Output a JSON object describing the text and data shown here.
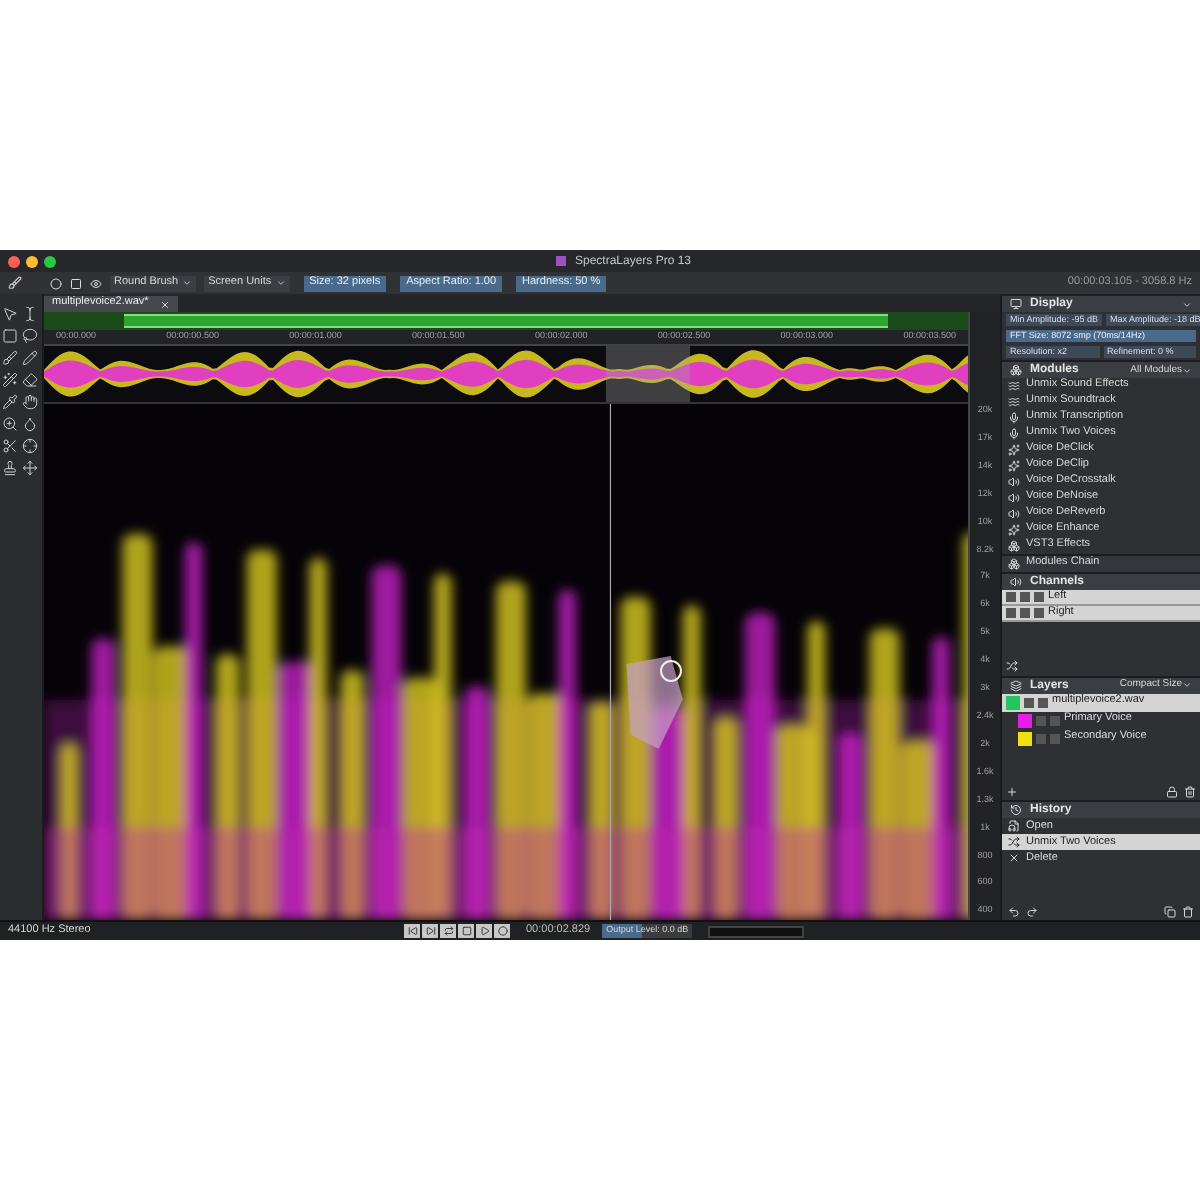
{
  "window": {
    "title": "SpectraLayers Pro 13"
  },
  "toolbar": {
    "brush": "Round Brush",
    "units": "Screen Units",
    "fields": [
      "Size: 32 pixels",
      "Aspect Ratio: 1.00",
      "Hardness: 50 %"
    ],
    "cursor_readout": "00:00:03.105 - 3058.8 Hz"
  },
  "document_tabs": [
    {
      "label": "multiplevoice2.wav*",
      "selected": true
    }
  ],
  "time_ruler": [
    "00:00.000",
    "00:00:00.500",
    "00:00:01.000",
    "00:00:01.500",
    "00:00:02.000",
    "00:00:02.500",
    "00:00:03.000",
    "00:00:03.500"
  ],
  "frequency_ruler": [
    "20k",
    "17k",
    "14k",
    "12k",
    "10k",
    "8.2k",
    "7k",
    "6k",
    "5k",
    "4k",
    "3k",
    "2.4k",
    "2k",
    "1.6k",
    "1.3k",
    "1k",
    "800",
    "600",
    "400"
  ],
  "display": {
    "title": "Display",
    "rows": [
      [
        "Min Amplitude: -95 dB",
        "Max Amplitude: -18 dB"
      ],
      [
        "FFT Size: 8072 smp (70ms/14Hz)"
      ],
      [
        "Resolution: x2",
        "Refinement: 0 %"
      ]
    ]
  },
  "modules": {
    "title": "Modules",
    "filter": "All Modules",
    "items": [
      "Unmix Sound Effects",
      "Unmix Soundtrack",
      "Unmix Transcription",
      "Unmix Two Voices",
      "Voice DeClick",
      "Voice DeClip",
      "Voice DeCrosstalk",
      "Voice DeNoise",
      "Voice DeReverb",
      "Voice Enhance",
      "VST3 Effects"
    ],
    "chain": "Modules Chain"
  },
  "channels": {
    "title": "Channels",
    "items": [
      {
        "name": "Left"
      },
      {
        "name": "Right"
      }
    ]
  },
  "layers": {
    "title": "Layers",
    "size": "Compact Size",
    "items": [
      {
        "name": "multiplevoice2.wav",
        "color": "#22c55e",
        "selected": true,
        "children": [
          {
            "name": "Primary Voice",
            "color": "#e81ee8",
            "selected": false
          },
          {
            "name": "Secondary Voice",
            "color": "#f0e010",
            "selected": false
          }
        ]
      }
    ]
  },
  "history": {
    "title": "History",
    "items": [
      {
        "kind": "open",
        "label": "Open",
        "selected": false
      },
      {
        "kind": "unmix",
        "label": "Unmix Two Voices",
        "selected": true
      },
      {
        "kind": "delete",
        "label": "Delete",
        "selected": false
      }
    ]
  },
  "status_bar": {
    "format": "44100 Hz Stereo",
    "time": "00:00:02.829",
    "output_level": {
      "label": "Output Level: 0.0 dB",
      "level": 0.45
    }
  }
}
